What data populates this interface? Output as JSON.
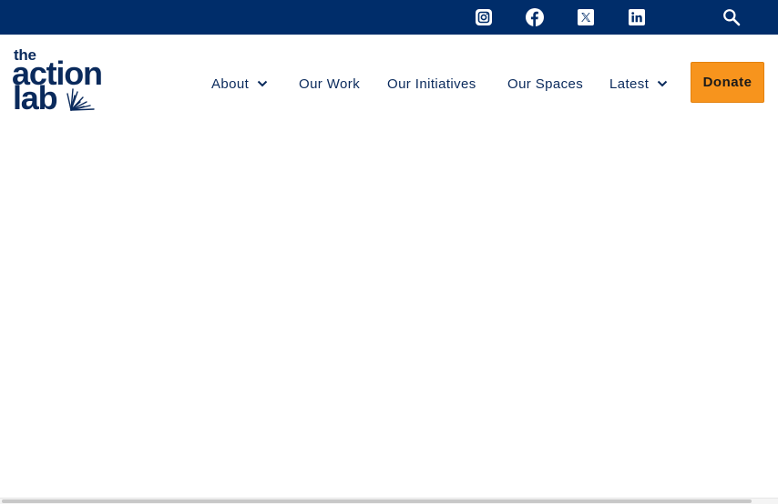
{
  "topbar": {
    "bg_color": "#002d6a",
    "icons": {
      "instagram": "instagram-icon",
      "facebook": "facebook-icon",
      "x": "x-twitter-icon",
      "linkedin": "linkedin-icon",
      "search": "search-icon"
    }
  },
  "logo": {
    "line1": "the",
    "line2": "action",
    "line3": "lab",
    "color": "#0a2a5c"
  },
  "nav": {
    "items": [
      {
        "label": "About",
        "has_dropdown": true
      },
      {
        "label": "Our Work",
        "has_dropdown": false
      },
      {
        "label": "Our Initiatives",
        "has_dropdown": false
      },
      {
        "label": "Our Spaces",
        "has_dropdown": false
      },
      {
        "label": "Latest",
        "has_dropdown": true
      }
    ],
    "donate_label": "Donate",
    "donate_color": "#f7941d"
  }
}
